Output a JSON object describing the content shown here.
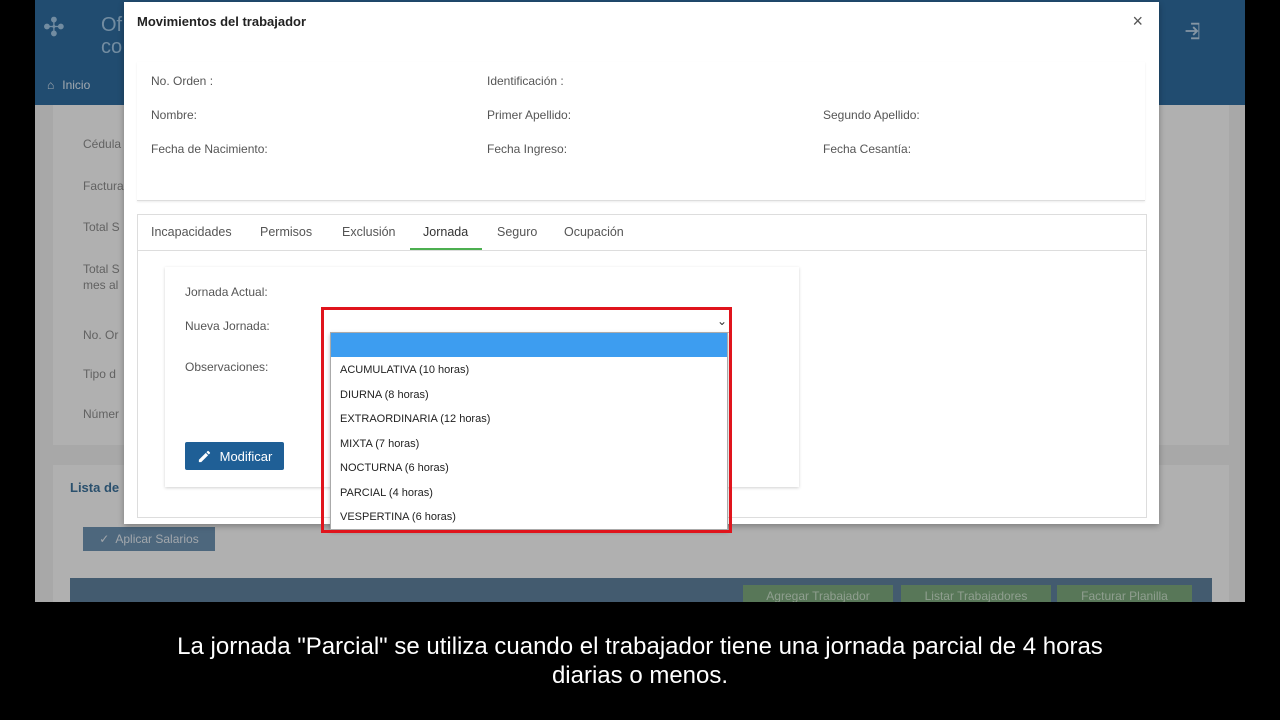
{
  "background": {
    "logo_text_1": "Of",
    "logo_text_2": "co",
    "nav_home": "Inicio",
    "labels": [
      "Cédula",
      "Factura",
      "Total S",
      "Total S",
      "mes al",
      "No. Or",
      "Tipo d",
      "Númer"
    ],
    "list_title": "Lista de",
    "aplicar_button": "Aplicar Salarios",
    "agregar_button": "Agregar Trabajador",
    "listar_button": "Listar Trabajadores",
    "facturar_button": "Facturar Planilla"
  },
  "modal": {
    "title": "Movimientos del trabajador",
    "close": "×",
    "info": {
      "no_orden": "No. Orden :",
      "identificacion": "Identificación :",
      "nombre": "Nombre:",
      "primer_apellido": "Primer Apellido:",
      "segundo_apellido": "Segundo Apellido:",
      "fecha_nacimiento": "Fecha de Nacimiento:",
      "fecha_ingreso": "Fecha Ingreso:",
      "fecha_cesantia": "Fecha Cesantía:"
    },
    "tabs": [
      "Incapacidades",
      "Permisos",
      "Exclusión",
      "Jornada",
      "Seguro",
      "Ocupación"
    ],
    "active_tab": "Jornada",
    "form": {
      "jornada_actual": "Jornada Actual:",
      "nueva_jornada": "Nueva Jornada:",
      "observaciones": "Observaciones:",
      "modificar_button": "Modificar"
    },
    "dropdown_options": [
      "",
      "ACUMULATIVA (10 horas)",
      "DIURNA (8 horas)",
      "EXTRAORDINARIA (12 horas)",
      "MIXTA (7 horas)",
      "NOCTURNA (6 horas)",
      "PARCIAL (4 horas)",
      "VESPERTINA (6 horas)"
    ]
  },
  "caption": {
    "line1": "La jornada \"Parcial\" se utiliza cuando el trabajador tiene una jornada parcial de 4 horas",
    "line2": "diarias o menos."
  },
  "colors": {
    "header_blue": "#2f6a9c",
    "button_blue": "#1f5f96",
    "selected_option": "#3d9df0",
    "highlight_red": "#e0141c",
    "tab_green": "#4caf50"
  }
}
